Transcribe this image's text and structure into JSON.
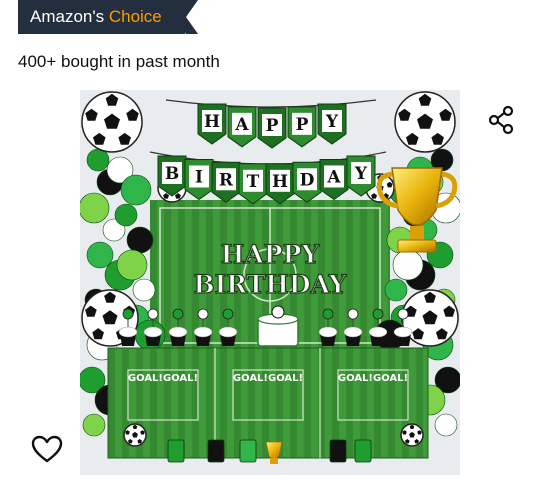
{
  "badge": {
    "prefix": "Amazon's",
    "highlight": "Choice"
  },
  "social_proof": {
    "text": "400+ bought in past month"
  },
  "product_image": {
    "banner_letters": [
      "H",
      "A",
      "P",
      "P",
      "Y",
      "B",
      "I",
      "R",
      "T",
      "H",
      "D",
      "A",
      "Y"
    ],
    "backdrop_line1": "HAPPY",
    "backdrop_line2": "BIRTHDAY",
    "table_text": "GOAL!GOAL!"
  },
  "icons": {
    "share": "share-icon",
    "favorite": "heart-outline-icon"
  },
  "colors": {
    "badge_bg": "#232f3e",
    "badge_accent": "#ff9900",
    "grass": "#2f8f2f"
  }
}
